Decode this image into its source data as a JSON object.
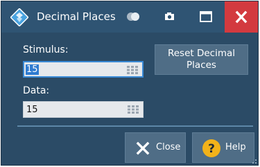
{
  "window": {
    "title": "Decimal Places"
  },
  "titlebar": {
    "logo_icon": "rohde-schwarz-logo-icon",
    "toggle_icon": "toggle-icon",
    "camera_icon": "camera-icon",
    "maximize_icon": "maximize-icon",
    "close_icon": "close-icon"
  },
  "form": {
    "stimulus_label": "Stimulus:",
    "stimulus_value": "15",
    "data_label": "Data:",
    "data_value": "15"
  },
  "buttons": {
    "reset_label": "Reset Decimal Places",
    "close_label": "Close",
    "help_label": "Help"
  },
  "colors": {
    "dialog_bg": "#2b4b66",
    "titlebar_bg": "#2f5473",
    "close_red": "#d33a3f",
    "focus_blue": "#3a8ad6",
    "help_yellow": "#f2b21a"
  }
}
